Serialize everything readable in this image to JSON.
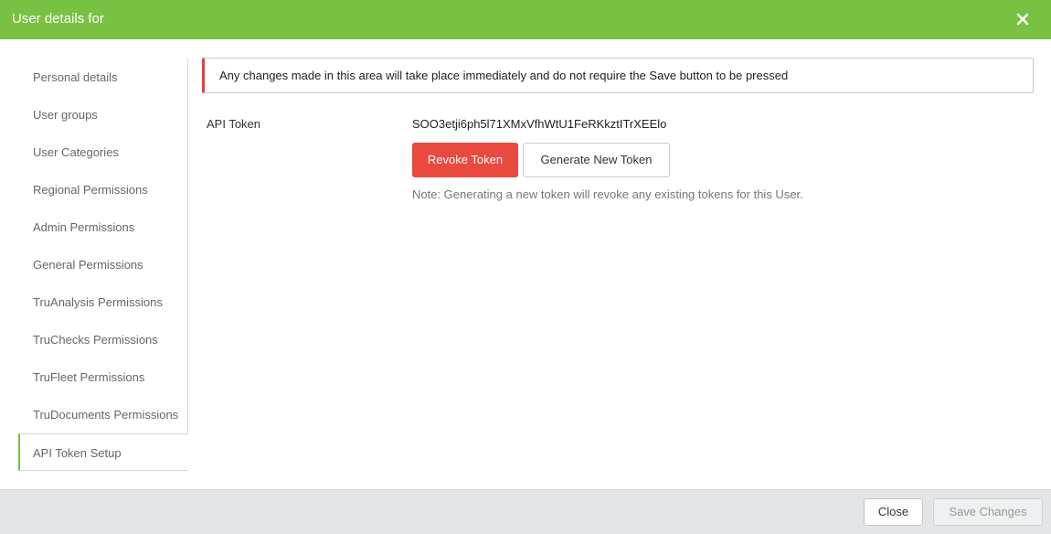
{
  "header": {
    "title": "User details for",
    "close_icon": "close-icon"
  },
  "sidebar": {
    "items": [
      {
        "label": "Personal details"
      },
      {
        "label": "User groups"
      },
      {
        "label": "User Categories"
      },
      {
        "label": "Regional Permissions"
      },
      {
        "label": "Admin Permissions"
      },
      {
        "label": "General Permissions"
      },
      {
        "label": "TruAnalysis Permissions"
      },
      {
        "label": "TruChecks Permissions"
      },
      {
        "label": "TruFleet Permissions"
      },
      {
        "label": "TruDocuments Permissions"
      },
      {
        "label": "API Token Setup",
        "active": true
      }
    ]
  },
  "main": {
    "alert_text": "Any changes made in this area will take place immediately and do not require the Save button to be pressed",
    "token_label": "API Token",
    "token_value": "SOO3etji6ph5l71XMxVfhWtU1FeRKkztITrXEElo",
    "revoke_label": "Revoke Token",
    "generate_label": "Generate New Token",
    "note": "Note: Generating a new token will revoke any existing tokens for this User."
  },
  "footer": {
    "close_label": "Close",
    "save_label": "Save Changes",
    "save_disabled": true
  },
  "colors": {
    "brand": "#79c142",
    "danger": "#e9493f",
    "footer_bg": "#e3e5e7"
  }
}
